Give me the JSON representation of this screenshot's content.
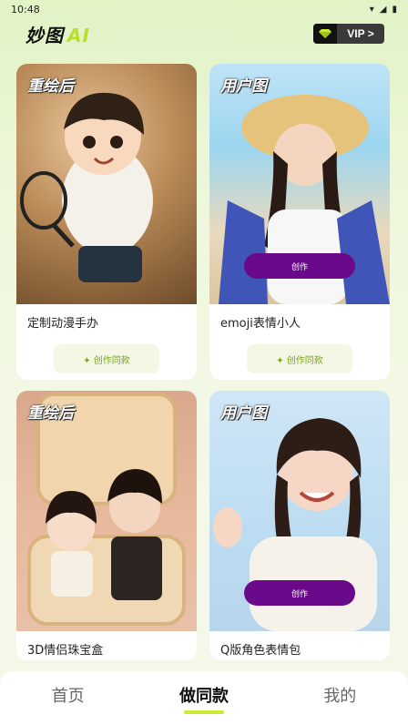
{
  "status_bar": {
    "time": "10:48",
    "icons": [
      "wifi-icon",
      "signal-icon",
      "battery-icon"
    ]
  },
  "header": {
    "logo_text": "妙图",
    "logo_ai": "AI",
    "vip_label": "VIP >"
  },
  "cards": [
    {
      "tag": "重绘后",
      "title": "定制动漫手办",
      "action": "✦ 创作同款",
      "create": ""
    },
    {
      "tag": "用户图",
      "title": "emoji表情小人",
      "action": "✦ 创作同款",
      "create": "创作"
    },
    {
      "tag": "重绘后",
      "title": "3D情侣珠宝盒",
      "action": "",
      "create": ""
    },
    {
      "tag": "用户图",
      "title": "Q版角色表情包",
      "action": "",
      "create": "创作"
    }
  ],
  "bottom_nav": [
    {
      "label": "首页"
    },
    {
      "label": "做同款"
    },
    {
      "label": "我的"
    }
  ],
  "colors": {
    "accent": "#c9ec33",
    "create_pill": "#6a0a8a",
    "action_text": "#7aa61a"
  }
}
